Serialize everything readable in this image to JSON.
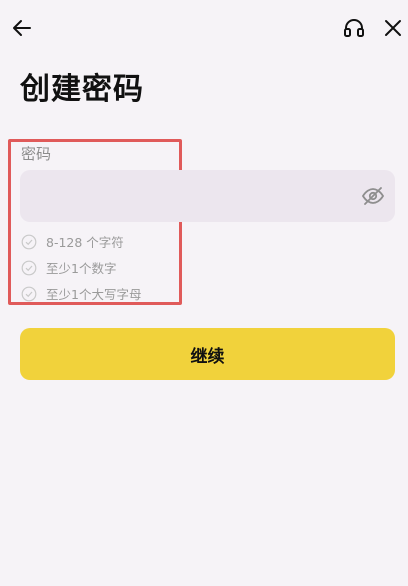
{
  "header": {
    "back_icon": "arrow-left-icon",
    "support_icon": "headset-icon",
    "close_icon": "close-icon"
  },
  "page": {
    "title": "创建密码"
  },
  "password": {
    "label": "密码",
    "value": "",
    "placeholder": "",
    "toggle_icon": "eye-off-icon"
  },
  "rules": [
    {
      "text": "8-128 个字符",
      "icon": "check-circle-icon"
    },
    {
      "text": "至少1个数字",
      "icon": "check-circle-icon"
    },
    {
      "text": "至少1个大写字母",
      "icon": "check-circle-icon"
    }
  ],
  "actions": {
    "continue_label": "继续"
  },
  "colors": {
    "background": "#f6f3f7",
    "input_bg": "#ece6ee",
    "accent": "#f1d23b",
    "highlight_border": "#e05a5a",
    "muted_text": "#9a9a9a"
  }
}
